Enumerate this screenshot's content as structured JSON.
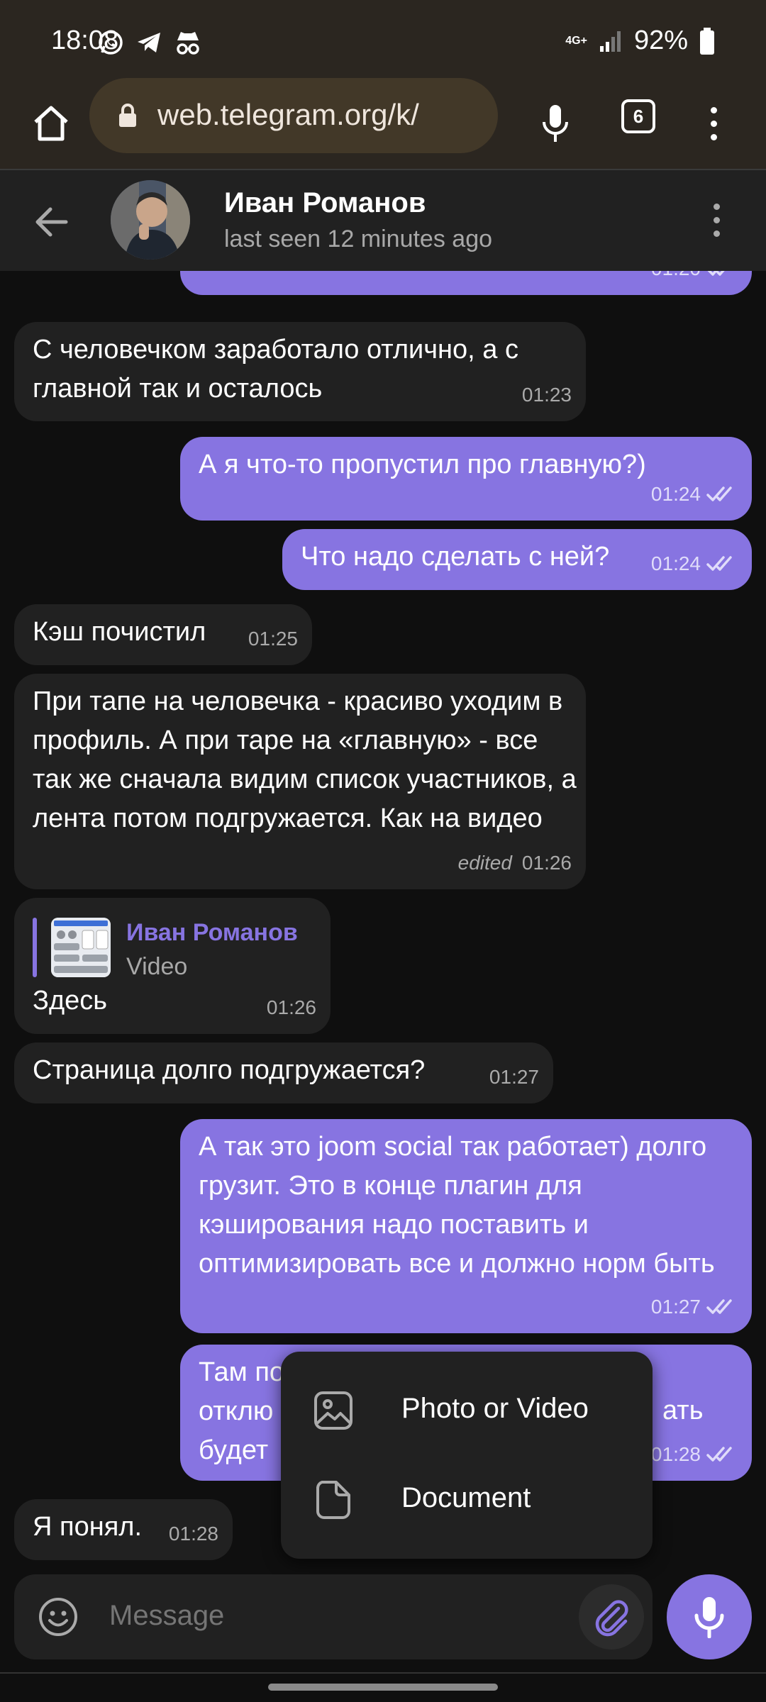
{
  "status_bar": {
    "time": "18:08",
    "network": "4G+",
    "battery": "92%"
  },
  "browser": {
    "url": "web.telegram.org/k/",
    "tab_count": "6"
  },
  "chat_header": {
    "name": "Иван Романов",
    "status": "last seen 12 minutes ago"
  },
  "messages": [
    {
      "dir": "out",
      "text": "",
      "time": "01:20"
    },
    {
      "dir": "in",
      "text": "С человечком заработало отлично, а с главной так и осталось",
      "time": "01:23"
    },
    {
      "dir": "out",
      "text": "А я что-то пропустил про главную?)",
      "time": "01:24"
    },
    {
      "dir": "out",
      "text": "Что надо сделать с ней?",
      "time": "01:24"
    },
    {
      "dir": "in",
      "text": "Кэш почистил",
      "time": "01:25"
    },
    {
      "dir": "in",
      "text": "При тапе на человечка - красиво уходим в профиль. А при таре на «главную» - все так же сначала видим список участников, а лента потом подгружается. Как на видео",
      "edited": "edited",
      "time": "01:26"
    },
    {
      "dir": "in",
      "reply_name": "Иван Романов",
      "reply_sub": "Video",
      "text": "Здесь",
      "time": "01:26"
    },
    {
      "dir": "in",
      "text": "Страница долго подгружается?",
      "time": "01:27"
    },
    {
      "dir": "out",
      "text": "А так это joom social так работает) долго грузит. Это в конце плагин для кэширования надо поставить и оптимизировать все и должно норм быть",
      "time": "01:27"
    },
    {
      "dir": "out",
      "text": "Там по",
      "text2": "отклю",
      "text3": "будет",
      "text_right": "ать",
      "time": "01:28"
    },
    {
      "dir": "in",
      "text": "Я понял.",
      "time": "01:28"
    }
  ],
  "attach_menu": {
    "photo_video": "Photo or Video",
    "document": "Document"
  },
  "composer": {
    "placeholder": "Message"
  },
  "colors": {
    "accent": "#8774e1",
    "incoming_bubble": "#212121",
    "background": "#0f0f0f",
    "browser_bar": "#2b2620"
  }
}
